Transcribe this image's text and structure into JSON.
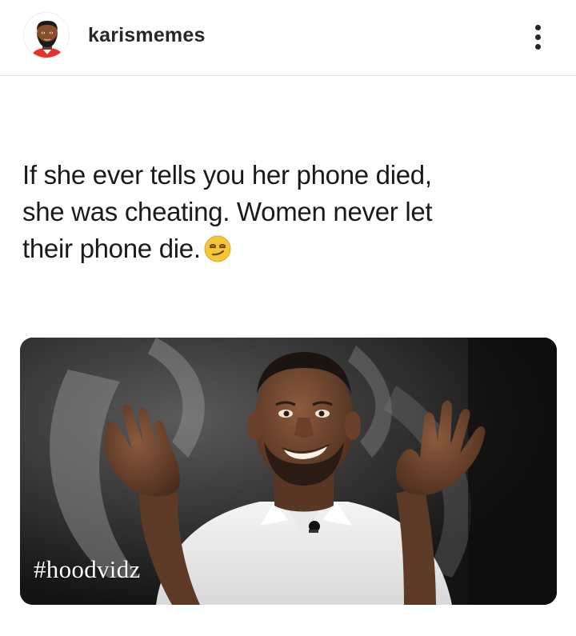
{
  "post": {
    "username": "karismemes",
    "avatar_icon": "cartoon-man-avatar",
    "menu_icon": "more-vertical-icon",
    "caption_lines": [
      "If she ever tells you her phone died,",
      "she was cheating. Women never let",
      "their phone die."
    ],
    "caption_emoji": "smirking-face-emoji",
    "image_watermark": "#hoodvidz"
  },
  "colors": {
    "text": "#262626",
    "divider": "#dcdcdc",
    "photo_bg": "#0e0e0e"
  }
}
